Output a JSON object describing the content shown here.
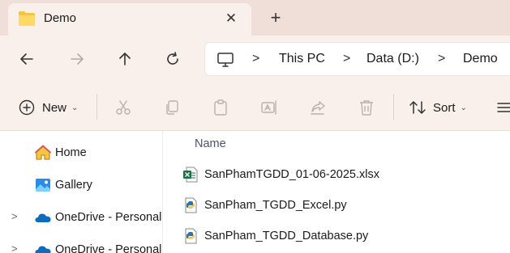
{
  "tab": {
    "title": "Demo",
    "close_icon": "close-icon",
    "new_tab_icon": "plus-icon"
  },
  "nav": {
    "back_icon": "arrow-left-icon",
    "forward_icon": "arrow-right-icon",
    "up_icon": "arrow-up-icon",
    "refresh_icon": "refresh-icon"
  },
  "address": {
    "crumbs": [
      "This PC",
      "Data (D:)",
      "Demo"
    ],
    "separator": ">"
  },
  "toolbar": {
    "new_label": "New",
    "sort_label": "Sort",
    "caret": "⌄"
  },
  "sidebar": {
    "items": [
      {
        "label": "Home",
        "icon": "home-icon",
        "expandable": false
      },
      {
        "label": "Gallery",
        "icon": "gallery-icon",
        "expandable": false
      },
      {
        "label": "OneDrive - Personal",
        "icon": "cloud-icon",
        "expandable": true
      },
      {
        "label": "OneDrive - Personal",
        "icon": "cloud-icon",
        "expandable": true
      }
    ],
    "expand_glyph": ">"
  },
  "content": {
    "column_name": "Name",
    "files": [
      {
        "name": "SanPhamTGDD_01-06-2025.xlsx",
        "icon": "excel-file-icon"
      },
      {
        "name": "SanPham_TGDD_Excel.py",
        "icon": "python-file-icon"
      },
      {
        "name": "SanPham_TGDD_Database.py",
        "icon": "python-file-icon"
      }
    ]
  },
  "colors": {
    "titlebar": "#f0ded8",
    "chrome": "#f9efeb",
    "folder": "#f4c543",
    "excel": "#1e7145",
    "onedrive": "#0f6cbd"
  }
}
